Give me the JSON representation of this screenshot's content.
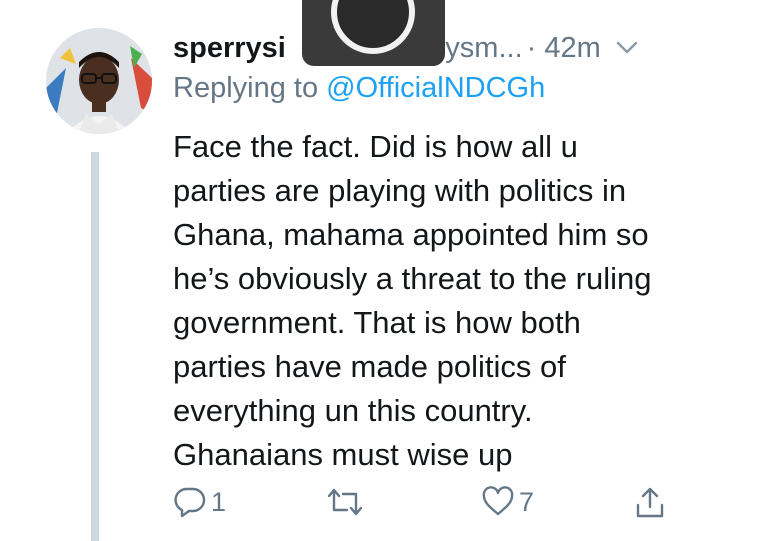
{
  "tweet": {
    "author_name": "sperrysi",
    "author_handle": "errysm...",
    "time": "· 42m",
    "replying_prefix": "Replying to ",
    "replying_to": "@OfficialNDCGh",
    "lines": [
      "Face the fact. Did is how all u",
      "parties are playing with politics in",
      "Ghana, mahama appointed him so",
      "he’s obviously a threat to the ruling",
      "government. That is how both",
      "parties have made politics of",
      "everything un this country.",
      "Ghanaians must wise up"
    ],
    "reply_count": "1",
    "retweet_count": "",
    "like_count": "7"
  },
  "icons": {
    "menu": "chevron-down-icon",
    "reply": "reply-icon",
    "retweet": "retweet-icon",
    "like": "heart-icon",
    "share": "share-icon"
  },
  "colors": {
    "text": "#14171a",
    "secondary": "#657786",
    "link": "#1da1f2",
    "thread_line": "#cfd6dd"
  }
}
